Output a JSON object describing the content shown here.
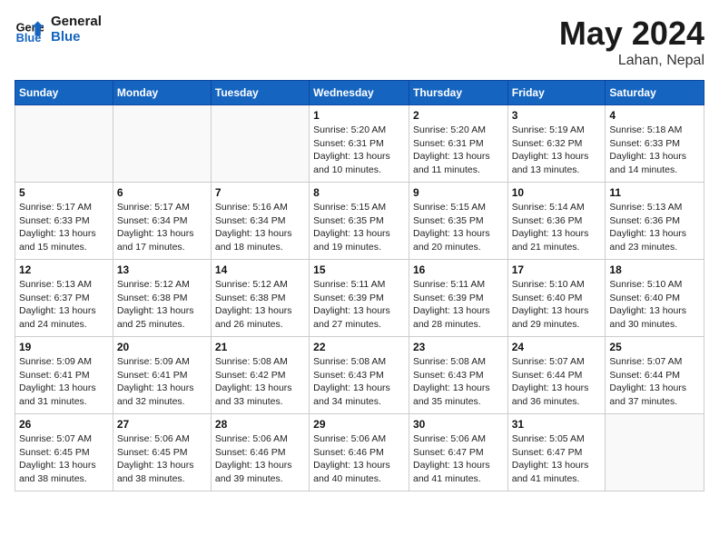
{
  "header": {
    "logo_line1": "General",
    "logo_line2": "Blue",
    "month_title": "May 2024",
    "location": "Lahan, Nepal"
  },
  "days_of_week": [
    "Sunday",
    "Monday",
    "Tuesday",
    "Wednesday",
    "Thursday",
    "Friday",
    "Saturday"
  ],
  "weeks": [
    [
      {
        "day": "",
        "text": ""
      },
      {
        "day": "",
        "text": ""
      },
      {
        "day": "",
        "text": ""
      },
      {
        "day": "1",
        "text": "Sunrise: 5:20 AM\nSunset: 6:31 PM\nDaylight: 13 hours\nand 10 minutes."
      },
      {
        "day": "2",
        "text": "Sunrise: 5:20 AM\nSunset: 6:31 PM\nDaylight: 13 hours\nand 11 minutes."
      },
      {
        "day": "3",
        "text": "Sunrise: 5:19 AM\nSunset: 6:32 PM\nDaylight: 13 hours\nand 13 minutes."
      },
      {
        "day": "4",
        "text": "Sunrise: 5:18 AM\nSunset: 6:33 PM\nDaylight: 13 hours\nand 14 minutes."
      }
    ],
    [
      {
        "day": "5",
        "text": "Sunrise: 5:17 AM\nSunset: 6:33 PM\nDaylight: 13 hours\nand 15 minutes."
      },
      {
        "day": "6",
        "text": "Sunrise: 5:17 AM\nSunset: 6:34 PM\nDaylight: 13 hours\nand 17 minutes."
      },
      {
        "day": "7",
        "text": "Sunrise: 5:16 AM\nSunset: 6:34 PM\nDaylight: 13 hours\nand 18 minutes."
      },
      {
        "day": "8",
        "text": "Sunrise: 5:15 AM\nSunset: 6:35 PM\nDaylight: 13 hours\nand 19 minutes."
      },
      {
        "day": "9",
        "text": "Sunrise: 5:15 AM\nSunset: 6:35 PM\nDaylight: 13 hours\nand 20 minutes."
      },
      {
        "day": "10",
        "text": "Sunrise: 5:14 AM\nSunset: 6:36 PM\nDaylight: 13 hours\nand 21 minutes."
      },
      {
        "day": "11",
        "text": "Sunrise: 5:13 AM\nSunset: 6:36 PM\nDaylight: 13 hours\nand 23 minutes."
      }
    ],
    [
      {
        "day": "12",
        "text": "Sunrise: 5:13 AM\nSunset: 6:37 PM\nDaylight: 13 hours\nand 24 minutes."
      },
      {
        "day": "13",
        "text": "Sunrise: 5:12 AM\nSunset: 6:38 PM\nDaylight: 13 hours\nand 25 minutes."
      },
      {
        "day": "14",
        "text": "Sunrise: 5:12 AM\nSunset: 6:38 PM\nDaylight: 13 hours\nand 26 minutes."
      },
      {
        "day": "15",
        "text": "Sunrise: 5:11 AM\nSunset: 6:39 PM\nDaylight: 13 hours\nand 27 minutes."
      },
      {
        "day": "16",
        "text": "Sunrise: 5:11 AM\nSunset: 6:39 PM\nDaylight: 13 hours\nand 28 minutes."
      },
      {
        "day": "17",
        "text": "Sunrise: 5:10 AM\nSunset: 6:40 PM\nDaylight: 13 hours\nand 29 minutes."
      },
      {
        "day": "18",
        "text": "Sunrise: 5:10 AM\nSunset: 6:40 PM\nDaylight: 13 hours\nand 30 minutes."
      }
    ],
    [
      {
        "day": "19",
        "text": "Sunrise: 5:09 AM\nSunset: 6:41 PM\nDaylight: 13 hours\nand 31 minutes."
      },
      {
        "day": "20",
        "text": "Sunrise: 5:09 AM\nSunset: 6:41 PM\nDaylight: 13 hours\nand 32 minutes."
      },
      {
        "day": "21",
        "text": "Sunrise: 5:08 AM\nSunset: 6:42 PM\nDaylight: 13 hours\nand 33 minutes."
      },
      {
        "day": "22",
        "text": "Sunrise: 5:08 AM\nSunset: 6:43 PM\nDaylight: 13 hours\nand 34 minutes."
      },
      {
        "day": "23",
        "text": "Sunrise: 5:08 AM\nSunset: 6:43 PM\nDaylight: 13 hours\nand 35 minutes."
      },
      {
        "day": "24",
        "text": "Sunrise: 5:07 AM\nSunset: 6:44 PM\nDaylight: 13 hours\nand 36 minutes."
      },
      {
        "day": "25",
        "text": "Sunrise: 5:07 AM\nSunset: 6:44 PM\nDaylight: 13 hours\nand 37 minutes."
      }
    ],
    [
      {
        "day": "26",
        "text": "Sunrise: 5:07 AM\nSunset: 6:45 PM\nDaylight: 13 hours\nand 38 minutes."
      },
      {
        "day": "27",
        "text": "Sunrise: 5:06 AM\nSunset: 6:45 PM\nDaylight: 13 hours\nand 38 minutes."
      },
      {
        "day": "28",
        "text": "Sunrise: 5:06 AM\nSunset: 6:46 PM\nDaylight: 13 hours\nand 39 minutes."
      },
      {
        "day": "29",
        "text": "Sunrise: 5:06 AM\nSunset: 6:46 PM\nDaylight: 13 hours\nand 40 minutes."
      },
      {
        "day": "30",
        "text": "Sunrise: 5:06 AM\nSunset: 6:47 PM\nDaylight: 13 hours\nand 41 minutes."
      },
      {
        "day": "31",
        "text": "Sunrise: 5:05 AM\nSunset: 6:47 PM\nDaylight: 13 hours\nand 41 minutes."
      },
      {
        "day": "",
        "text": ""
      }
    ]
  ]
}
